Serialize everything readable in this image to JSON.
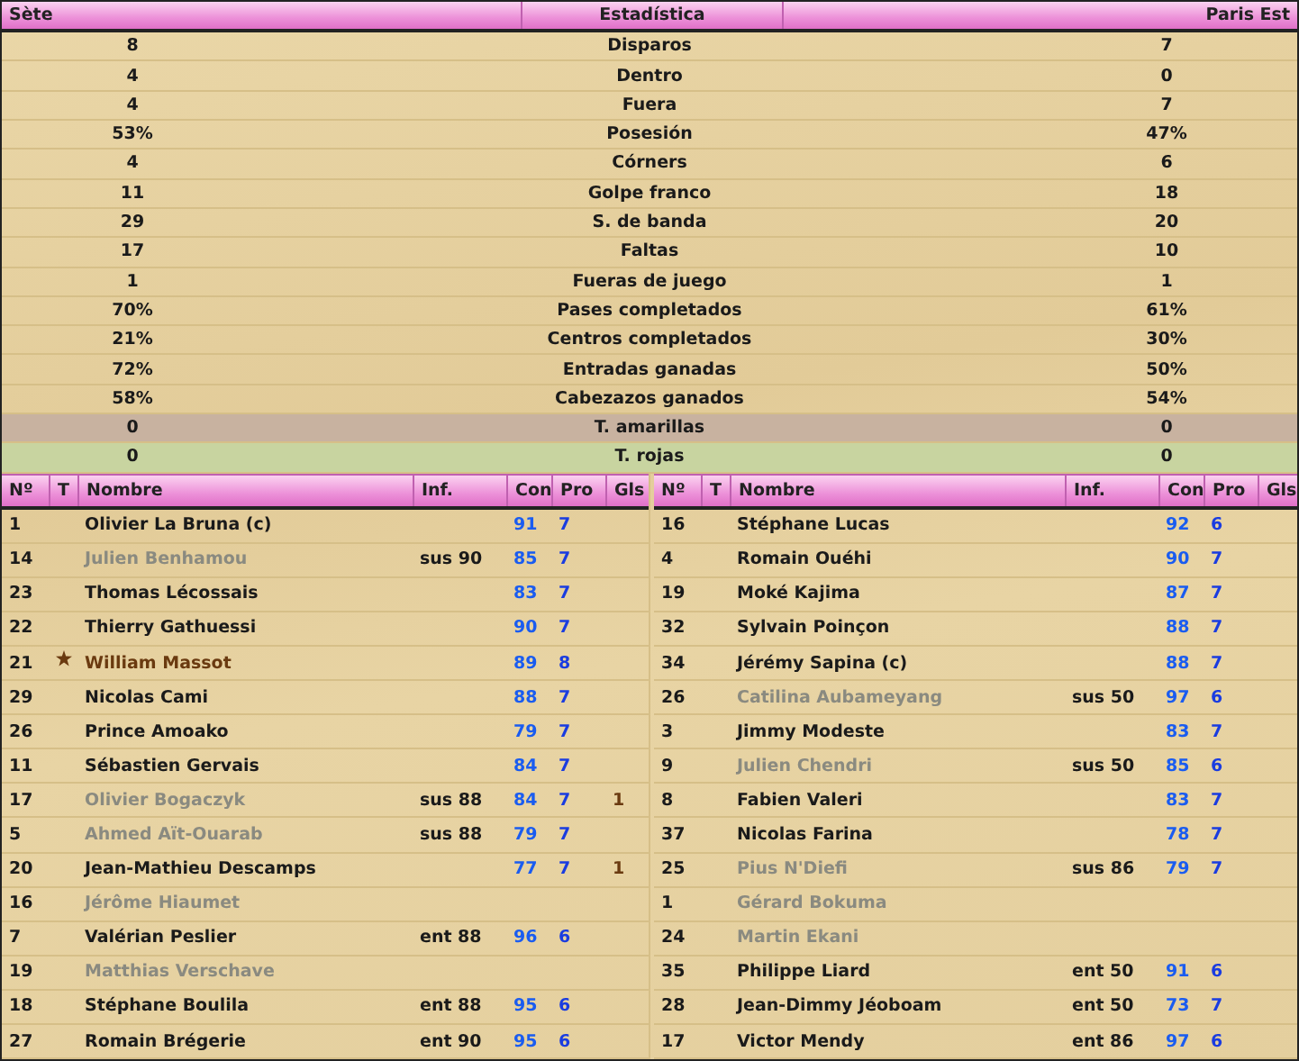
{
  "stats": {
    "columns": [
      "Sète",
      "Estadística",
      "Paris Est"
    ],
    "rows": [
      {
        "kind": "normal",
        "home": "8",
        "label": "Disparos",
        "away": "7"
      },
      {
        "kind": "normal",
        "home": "4",
        "label": "Dentro",
        "away": "0"
      },
      {
        "kind": "normal",
        "home": "4",
        "label": "Fuera",
        "away": "7"
      },
      {
        "kind": "normal",
        "home": "53%",
        "label": "Posesión",
        "away": "47%"
      },
      {
        "kind": "normal",
        "home": "4",
        "label": "Córners",
        "away": "6"
      },
      {
        "kind": "normal",
        "home": "11",
        "label": "Golpe franco",
        "away": "18"
      },
      {
        "kind": "normal",
        "home": "29",
        "label": "S. de banda",
        "away": "20"
      },
      {
        "kind": "normal",
        "home": "17",
        "label": "Faltas",
        "away": "10"
      },
      {
        "kind": "normal",
        "home": "1",
        "label": "Fueras de juego",
        "away": "1"
      },
      {
        "kind": "normal",
        "home": "70%",
        "label": "Pases completados",
        "away": "61%"
      },
      {
        "kind": "normal",
        "home": "21%",
        "label": "Centros completados",
        "away": "30%"
      },
      {
        "kind": "normal",
        "home": "72%",
        "label": "Entradas ganadas",
        "away": "50%"
      },
      {
        "kind": "normal",
        "home": "58%",
        "label": "Cabezazos ganados",
        "away": "54%"
      },
      {
        "kind": "yellow",
        "home": "0",
        "label": "T. amarillas",
        "away": "0"
      },
      {
        "kind": "red",
        "home": "0",
        "label": "T. rojas",
        "away": "0"
      }
    ]
  },
  "lineups": [
    {
      "columns": [
        "Nº",
        "T",
        "Nombre",
        "Inf.",
        "Con",
        "Pro",
        "Gls"
      ],
      "players": [
        {
          "number": "1",
          "name": "Olivier La Bruna (c)",
          "con": "91",
          "pro": "7",
          "greyed": false,
          "star": false
        },
        {
          "number": "14",
          "name": "Julien Benhamou",
          "info": "sus 90",
          "con": "85",
          "pro": "7",
          "greyed": true,
          "star": false
        },
        {
          "number": "23",
          "name": "Thomas Lécossais",
          "con": "83",
          "pro": "7",
          "greyed": false,
          "star": false
        },
        {
          "number": "22",
          "name": "Thierry Gathuessi",
          "con": "90",
          "pro": "7",
          "greyed": false,
          "star": false
        },
        {
          "number": "21",
          "name": "William Massot",
          "con": "89",
          "pro": "8",
          "greyed": false,
          "star": true
        },
        {
          "number": "29",
          "name": "Nicolas Cami",
          "con": "88",
          "pro": "7",
          "greyed": false,
          "star": false
        },
        {
          "number": "26",
          "name": "Prince Amoako",
          "con": "79",
          "pro": "7",
          "greyed": false,
          "star": false
        },
        {
          "number": "11",
          "name": "Sébastien Gervais",
          "con": "84",
          "pro": "7",
          "greyed": false,
          "star": false
        },
        {
          "number": "17",
          "name": "Olivier Bogaczyk",
          "info": "sus 88",
          "con": "84",
          "pro": "7",
          "goals": "1",
          "greyed": true,
          "star": false
        },
        {
          "number": "5",
          "name": "Ahmed Aït-Ouarab",
          "info": "sus 88",
          "con": "79",
          "pro": "7",
          "greyed": true,
          "star": false
        },
        {
          "number": "20",
          "name": "Jean-Mathieu Descamps",
          "con": "77",
          "pro": "7",
          "goals": "1",
          "greyed": false,
          "star": false
        },
        {
          "number": "16",
          "name": "Jérôme Hiaumet",
          "greyed": true,
          "star": false
        },
        {
          "number": "7",
          "name": "Valérian Peslier",
          "info": "ent 88",
          "con": "96",
          "pro": "6",
          "greyed": false,
          "star": false
        },
        {
          "number": "19",
          "name": "Matthias Verschave",
          "greyed": true,
          "star": false
        },
        {
          "number": "18",
          "name": "Stéphane Boulila",
          "info": "ent 88",
          "con": "95",
          "pro": "6",
          "greyed": false,
          "star": false
        },
        {
          "number": "27",
          "name": "Romain Brégerie",
          "info": "ent 90",
          "con": "95",
          "pro": "6",
          "greyed": false,
          "star": false
        }
      ]
    },
    {
      "columns": [
        "Nº",
        "T",
        "Nombre",
        "Inf.",
        "Con",
        "Pro",
        "Gls"
      ],
      "players": [
        {
          "number": "16",
          "name": "Stéphane Lucas",
          "con": "92",
          "pro": "6",
          "greyed": false,
          "star": false
        },
        {
          "number": "4",
          "name": "Romain Ouéhi",
          "con": "90",
          "pro": "7",
          "greyed": false,
          "star": false
        },
        {
          "number": "19",
          "name": "Moké Kajima",
          "con": "87",
          "pro": "7",
          "greyed": false,
          "star": false
        },
        {
          "number": "32",
          "name": "Sylvain Poinçon",
          "con": "88",
          "pro": "7",
          "greyed": false,
          "star": false
        },
        {
          "number": "34",
          "name": "Jérémy Sapina (c)",
          "con": "88",
          "pro": "7",
          "greyed": false,
          "star": false
        },
        {
          "number": "26",
          "name": "Catilina Aubameyang",
          "info": "sus 50",
          "con": "97",
          "pro": "6",
          "greyed": true,
          "star": false
        },
        {
          "number": "3",
          "name": "Jimmy Modeste",
          "con": "83",
          "pro": "7",
          "greyed": false,
          "star": false
        },
        {
          "number": "9",
          "name": "Julien Chendri",
          "info": "sus 50",
          "con": "85",
          "pro": "6",
          "greyed": true,
          "star": false
        },
        {
          "number": "8",
          "name": "Fabien Valeri",
          "con": "83",
          "pro": "7",
          "greyed": false,
          "star": false
        },
        {
          "number": "37",
          "name": "Nicolas Farina",
          "con": "78",
          "pro": "7",
          "greyed": false,
          "star": false
        },
        {
          "number": "25",
          "name": "Pius N'Diefi",
          "info": "sus 86",
          "con": "79",
          "pro": "7",
          "greyed": true,
          "star": false
        },
        {
          "number": "1",
          "name": "Gérard Bokuma",
          "greyed": true,
          "star": false
        },
        {
          "number": "24",
          "name": "Martin Ekani",
          "greyed": true,
          "star": false
        },
        {
          "number": "35",
          "name": "Philippe Liard",
          "info": "ent 50",
          "con": "91",
          "pro": "6",
          "greyed": false,
          "star": false
        },
        {
          "number": "28",
          "name": "Jean-Dimmy Jéoboam",
          "info": "ent 50",
          "con": "73",
          "pro": "7",
          "greyed": false,
          "star": false
        },
        {
          "number": "17",
          "name": "Victor Mendy",
          "info": "ent 86",
          "con": "97",
          "pro": "6",
          "greyed": false,
          "star": false
        }
      ]
    }
  ]
}
